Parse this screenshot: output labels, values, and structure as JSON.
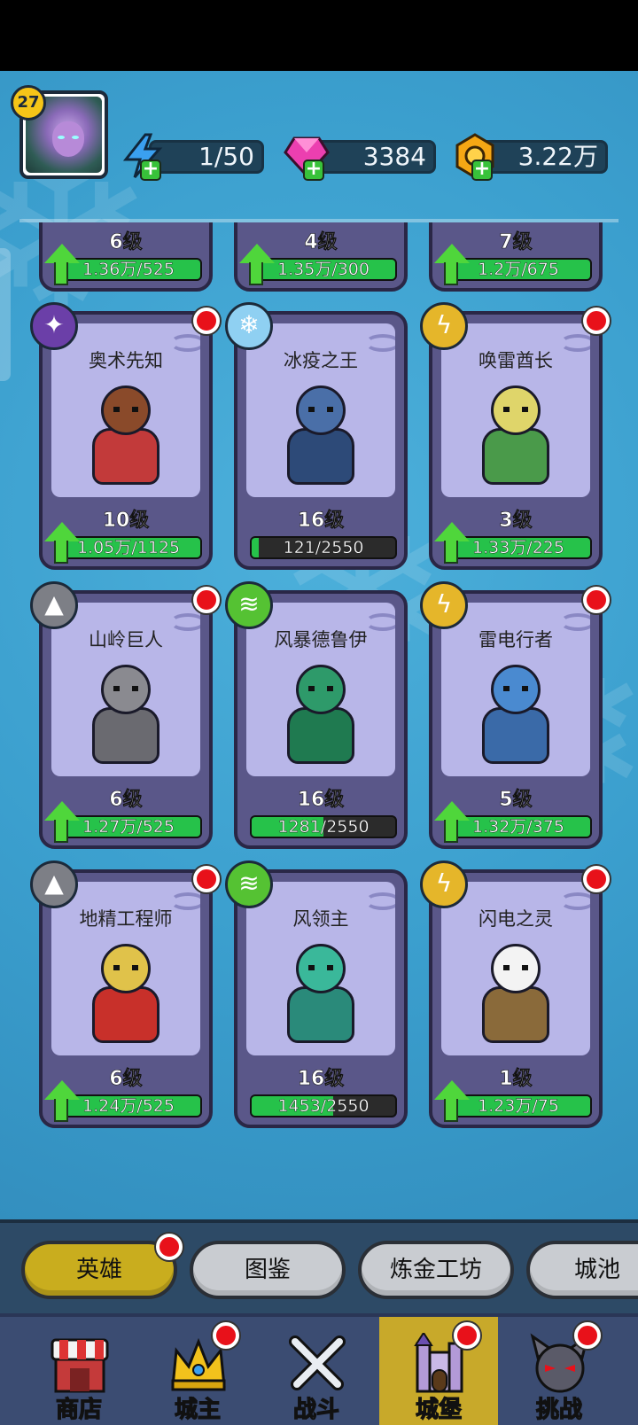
{
  "player": {
    "level": "27"
  },
  "resources": {
    "energy": "1/50",
    "gems": "3384",
    "gold": "3.22万"
  },
  "heroes": [
    {
      "name": "",
      "level": "6级",
      "progress": "1.36万/525",
      "upgradable": true,
      "fill": 1.0,
      "type_icon": "",
      "new_dot": false
    },
    {
      "name": "",
      "level": "4级",
      "progress": "1.35万/300",
      "upgradable": true,
      "fill": 1.0,
      "type_icon": "",
      "new_dot": false
    },
    {
      "name": "",
      "level": "7级",
      "progress": "1.2万/675",
      "upgradable": true,
      "fill": 1.0,
      "type_icon": "",
      "new_dot": false
    },
    {
      "name": "奥术先知",
      "level": "10级",
      "progress": "1.05万/1125",
      "upgradable": true,
      "fill": 1.0,
      "type_icon": "arcane-icon",
      "new_dot": true
    },
    {
      "name": "冰疫之王",
      "level": "16级",
      "progress": "121/2550",
      "upgradable": false,
      "fill": 0.047,
      "type_icon": "ice-icon",
      "new_dot": false
    },
    {
      "name": "唤雷酋长",
      "level": "3级",
      "progress": "1.33万/225",
      "upgradable": true,
      "fill": 1.0,
      "type_icon": "thunder-icon",
      "new_dot": true
    },
    {
      "name": "山岭巨人",
      "level": "6级",
      "progress": "1.27万/525",
      "upgradable": true,
      "fill": 1.0,
      "type_icon": "rock-icon",
      "new_dot": true
    },
    {
      "name": "风暴德鲁伊",
      "level": "16级",
      "progress": "1281/2550",
      "upgradable": false,
      "fill": 0.502,
      "type_icon": "wind-icon",
      "new_dot": false
    },
    {
      "name": "雷电行者",
      "level": "5级",
      "progress": "1.32万/375",
      "upgradable": true,
      "fill": 1.0,
      "type_icon": "lightning-icon",
      "new_dot": true
    },
    {
      "name": "地精工程师",
      "level": "6级",
      "progress": "1.24万/525",
      "upgradable": true,
      "fill": 1.0,
      "type_icon": "rock-icon",
      "new_dot": true
    },
    {
      "name": "风领主",
      "level": "16级",
      "progress": "1453/2550",
      "upgradable": false,
      "fill": 0.57,
      "type_icon": "wind-icon",
      "new_dot": false
    },
    {
      "name": "闪电之灵",
      "level": "1级",
      "progress": "1.23万/75",
      "upgradable": true,
      "fill": 1.0,
      "type_icon": "lightning-icon",
      "new_dot": true
    }
  ],
  "subtabs": {
    "heroes": "英雄",
    "codex": "图鉴",
    "alchemy": "炼金工坊",
    "city": "城池"
  },
  "nav": {
    "shop": "商店",
    "lord": "城主",
    "battle": "战斗",
    "castle": "城堡",
    "challenge": "挑战"
  },
  "colors": {
    "background": "#3b9fce",
    "card": "#5a5789",
    "progress_green": "#26c24a",
    "active_tab": "#c9ad1e",
    "red_dot": "#e8111a"
  }
}
